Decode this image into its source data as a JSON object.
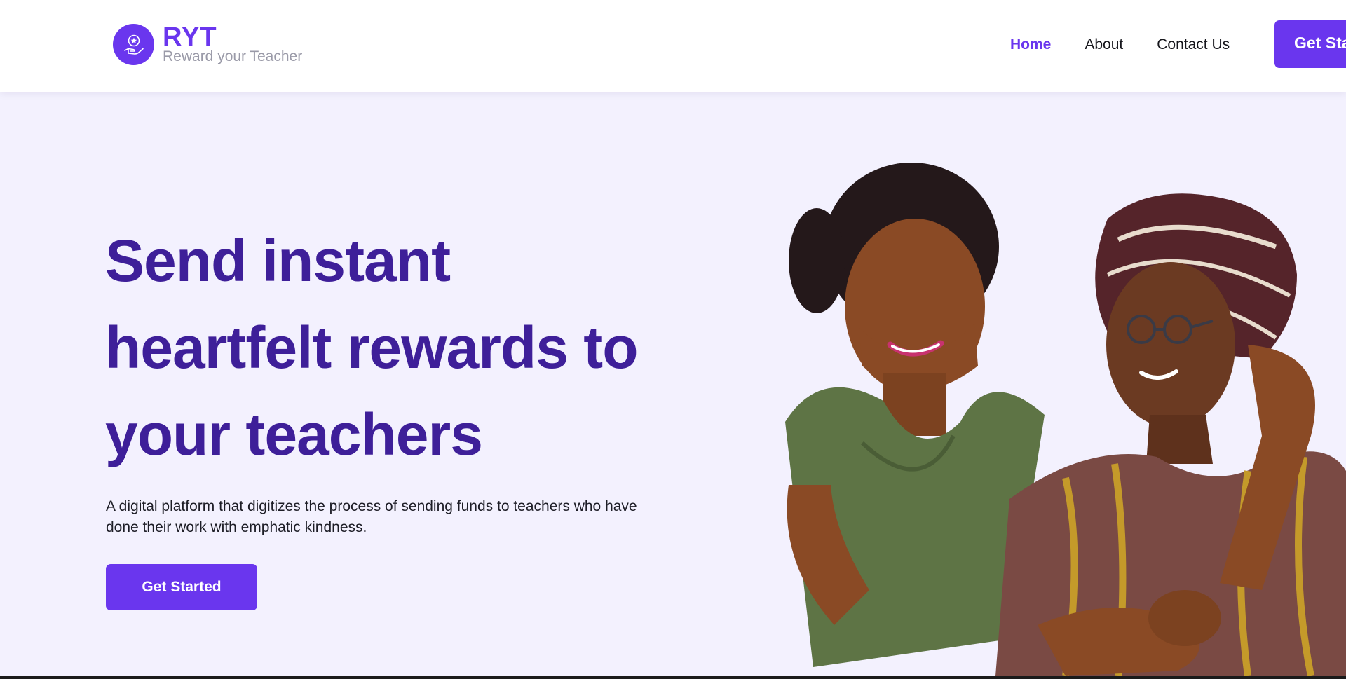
{
  "brand": {
    "name": "RYT",
    "tagline": "Reward your Teacher",
    "primary_color": "#6a36ee",
    "heading_color": "#3e1f99",
    "logo_icon": "hand-holding-star-coin-icon"
  },
  "nav": {
    "items": [
      {
        "label": "Home",
        "active": true
      },
      {
        "label": "About",
        "active": false
      },
      {
        "label": "Contact Us",
        "active": false
      }
    ],
    "cta_label": "Get Started"
  },
  "hero": {
    "title": "Send instant heartfelt rewards to your teachers",
    "description": "A digital platform that digitizes the process of sending funds to teachers who have done their work with emphatic kindness.",
    "cta_label": "Get Started",
    "background_color": "#f3f1fe",
    "image": "hero-photo-student-hugging-teacher"
  }
}
